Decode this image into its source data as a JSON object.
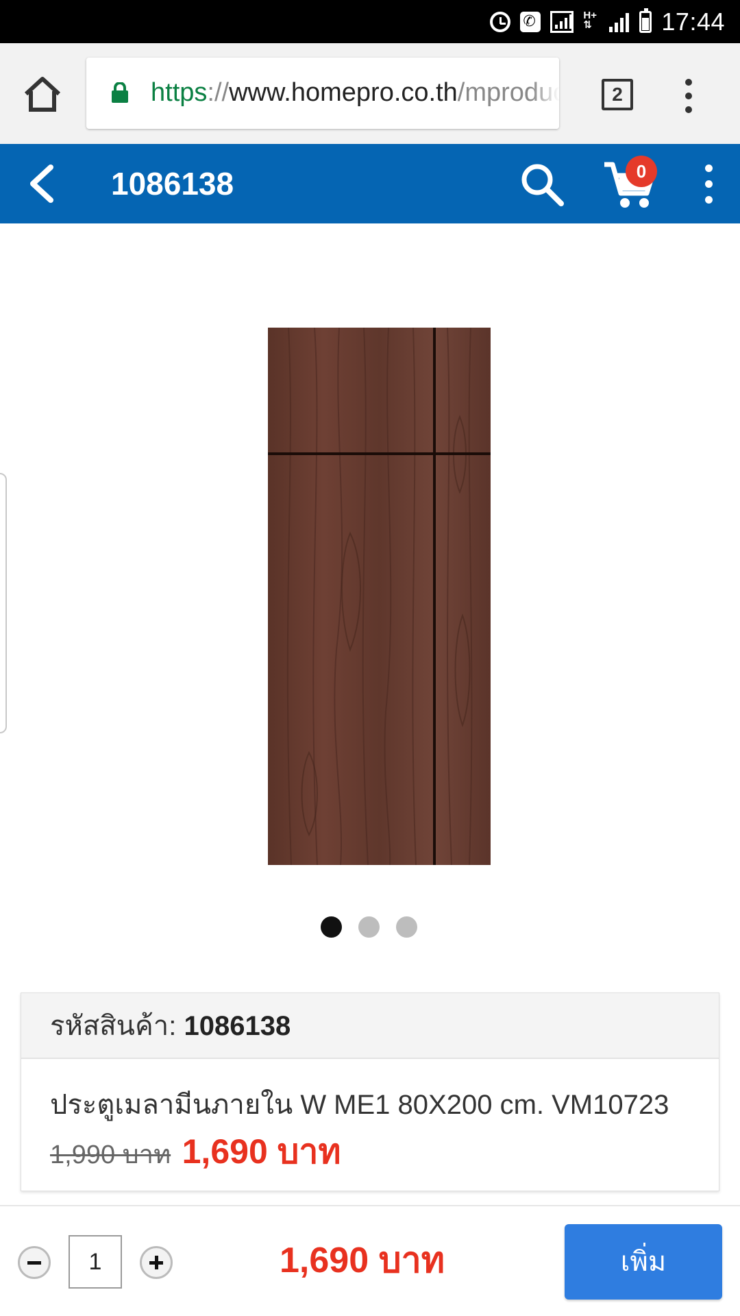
{
  "status_bar": {
    "time": "17:44",
    "icons": [
      "alarm-icon",
      "call-icon",
      "signal-box-icon",
      "h-plus-icon",
      "cell-signal-icon",
      "battery-icon"
    ]
  },
  "browser": {
    "url_scheme": "https",
    "url_separator": "://",
    "url_host": "www.homepro.co.th",
    "url_path": "/mproduct",
    "tab_count": "2",
    "colors": {
      "lock": "#0b8043",
      "toolbar": "#f2f2f2"
    }
  },
  "header": {
    "title": "1086138",
    "cart_count": "0",
    "colors": {
      "background": "#0565b3",
      "badge": "#e53a2a"
    }
  },
  "product": {
    "image_alt": "door",
    "carousel": {
      "total": 3,
      "active": 1
    },
    "code_label": "รหัสสินค้า:",
    "code_value": "1086138",
    "name": "ประตูเมลามีนภายใน W ME1 80X200 cm. VM10723",
    "old_price": "1,990 บาท",
    "price": "1,690 บาท",
    "colors": {
      "price": "#e8311f"
    }
  },
  "bottom_bar": {
    "quantity": "1",
    "total": "1,690 บาท",
    "add_label": "เพิ่ม",
    "colors": {
      "add_button": "#2f7de0"
    }
  }
}
